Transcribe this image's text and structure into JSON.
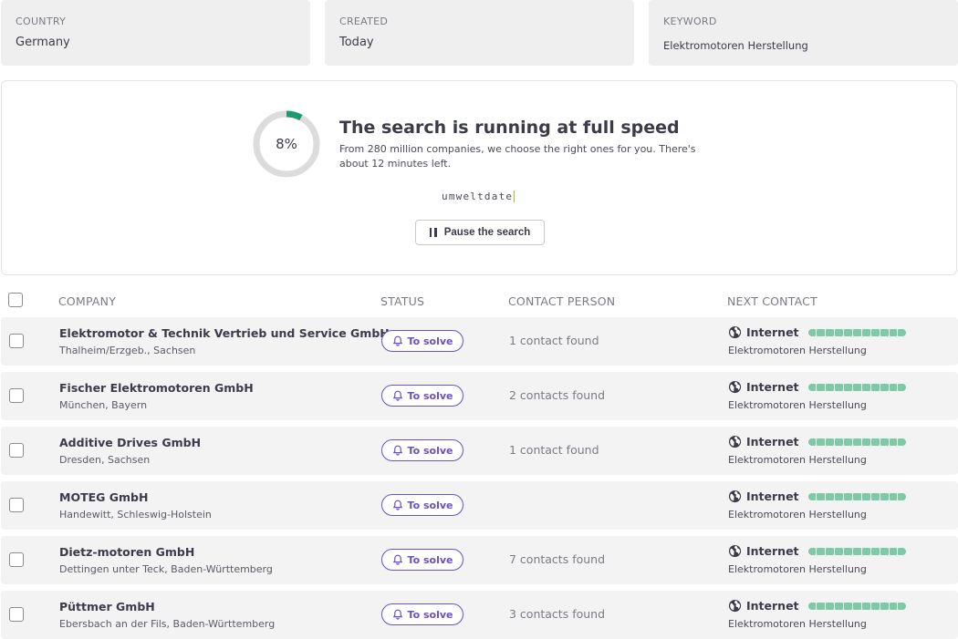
{
  "filters": {
    "country": {
      "label": "COUNTRY",
      "value": "Germany"
    },
    "created": {
      "label": "CREATED",
      "value": "Today"
    },
    "keyword": {
      "label": "KEYWORD",
      "value": "Elektromotoren Herstellung"
    }
  },
  "progress": {
    "percent_label": "8%",
    "percent_value": 8,
    "title": "The search is running at full speed",
    "subtitle": "From 280 million companies, we choose the right ones for you. There's about 12 minutes left.",
    "typing_text": "umweltdate",
    "pause_label": "Pause the search",
    "colors": {
      "track": "#dcdcdc",
      "fill": "#1f9a6e"
    }
  },
  "table": {
    "headers": {
      "company": "COMPANY",
      "status": "STATUS",
      "contact_person": "CONTACT PERSON",
      "next_contact": "NEXT CONTACT"
    },
    "rows": [
      {
        "company": "Elektromotor & Technik Vertrieb und Service GmbH",
        "location": "Thalheim/Erzgeb., Sachsen",
        "status": "To solve",
        "contacts": "1 contact found",
        "next_source": "Internet",
        "next_keyword": "Elektromotoren Herstellung"
      },
      {
        "company": "Fischer Elektromotoren GmbH",
        "location": "München, Bayern",
        "status": "To solve",
        "contacts": "2 contacts found",
        "next_source": "Internet",
        "next_keyword": "Elektromotoren Herstellung"
      },
      {
        "company": "Additive Drives GmbH",
        "location": "Dresden, Sachsen",
        "status": "To solve",
        "contacts": "1 contact found",
        "next_source": "Internet",
        "next_keyword": "Elektromotoren Herstellung"
      },
      {
        "company": "MOTEG GmbH",
        "location": "Handewitt, Schleswig-Holstein",
        "status": "To solve",
        "contacts": "",
        "next_source": "Internet",
        "next_keyword": "Elektromotoren Herstellung"
      },
      {
        "company": "Dietz-motoren GmbH",
        "location": "Dettingen unter Teck, Baden-Württemberg",
        "status": "To solve",
        "contacts": "7 contacts found",
        "next_source": "Internet",
        "next_keyword": "Elektromotoren Herstellung"
      },
      {
        "company": "Püttmer GmbH",
        "location": "Ebersbach an der Fils, Baden-Württemberg",
        "status": "To solve",
        "contacts": "3 contacts found",
        "next_source": "Internet",
        "next_keyword": "Elektromotoren Herstellung"
      }
    ]
  },
  "icons": {
    "status": "bell-icon",
    "next_contact": "globe-icon",
    "pause": "pause-icon"
  },
  "colors": {
    "accent": "#6b4fc4",
    "signal": "#7ccaa6"
  }
}
